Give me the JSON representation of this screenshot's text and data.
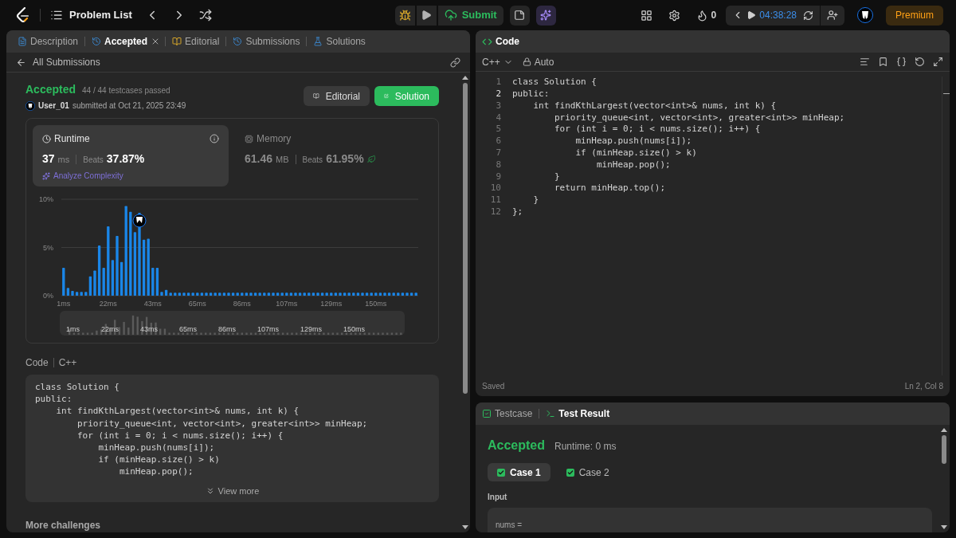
{
  "topbar": {
    "problem_list": "Problem List",
    "submit": "Submit",
    "streak": "0",
    "timer": "04:38:28",
    "premium": "Premium"
  },
  "left_panel": {
    "tabs": [
      {
        "label": "Description",
        "selected": false,
        "kind": "description",
        "closable": false
      },
      {
        "label": "Accepted",
        "selected": true,
        "kind": "history",
        "closable": true
      },
      {
        "label": "Editorial",
        "selected": false,
        "kind": "book",
        "closable": false
      },
      {
        "label": "Submissions",
        "selected": false,
        "kind": "history",
        "closable": false
      },
      {
        "label": "Solutions",
        "selected": false,
        "kind": "flask",
        "closable": false
      }
    ],
    "back": "All Submissions",
    "result": {
      "status": "Accepted",
      "testcases": "44 / 44 testcases passed",
      "user": "User_01",
      "submitted": "submitted at Oct 21, 2025 23:49"
    },
    "buttons": [
      {
        "label": "Editorial",
        "kind": "secondary"
      },
      {
        "label": "Solution",
        "kind": "primary"
      }
    ],
    "stats": [
      {
        "kind": "runtime",
        "title": "Runtime",
        "value": "37",
        "unit": "ms",
        "beats_label": "Beats",
        "beats": "37.87%",
        "selected": true,
        "link": "Analyze Complexity"
      },
      {
        "kind": "memory",
        "title": "Memory",
        "value": "61.46",
        "unit": "MB",
        "beats_label": "Beats",
        "beats": "61.95%",
        "selected": false
      }
    ],
    "chart_data": {
      "type": "bar",
      "ylim": [
        0,
        10
      ],
      "yticks": [
        {
          "value": 0,
          "label": "0%"
        },
        {
          "value": 5,
          "label": "5%"
        },
        {
          "value": 10,
          "label": "10%"
        }
      ],
      "categories": [
        "1ms",
        null,
        null,
        null,
        null,
        null,
        null,
        null,
        null,
        null,
        "22ms",
        null,
        null,
        null,
        null,
        null,
        null,
        null,
        null,
        null,
        "43ms",
        null,
        null,
        null,
        null,
        null,
        null,
        null,
        null,
        null,
        "65ms",
        null,
        null,
        null,
        null,
        null,
        null,
        null,
        null,
        null,
        "86ms",
        null,
        null,
        null,
        null,
        null,
        null,
        null,
        null,
        null,
        "107ms",
        null,
        null,
        null,
        null,
        null,
        null,
        null,
        null,
        null,
        "129ms",
        null,
        null,
        null,
        null,
        null,
        null,
        null,
        null,
        null,
        "150ms",
        null,
        null,
        null,
        null,
        null,
        null,
        null,
        null,
        null
      ],
      "values": [
        2.9,
        0.8,
        0.5,
        0.4,
        0.4,
        0.4,
        2.0,
        2.6,
        5.2,
        2.9,
        7.2,
        3.7,
        6.2,
        3.5,
        9.3,
        8.7,
        6.6,
        8.6,
        5.8,
        5.9,
        2.9,
        2.9,
        0.4,
        0.6,
        0.3,
        0.3,
        0.3,
        0.3,
        0.3,
        0.3,
        0.3,
        0.3,
        0.3,
        0.3,
        0.3,
        0.3,
        0.3,
        0.3,
        0.3,
        0.3,
        0.3,
        0.3,
        0.3,
        0.3,
        0.3,
        0.3,
        0.3,
        0.3,
        0.3,
        0.3,
        0.3,
        0.3,
        0.3,
        0.3,
        0.3,
        0.3,
        0.3,
        0.3,
        0.3,
        0.3,
        0.3,
        0.3,
        0.3,
        0.3,
        0.3,
        0.3,
        0.3,
        0.3,
        0.3,
        0.3,
        0.3,
        0.3,
        0.3,
        0.3,
        0.3,
        0.3,
        0.3,
        0.3,
        0.3,
        0.3
      ]
    },
    "brush_labels": [
      "1ms",
      "22ms",
      "43ms",
      "65ms",
      "86ms",
      "107ms",
      "129ms",
      "150ms"
    ],
    "code_label": "Code",
    "code_language": "C++",
    "code_lines": [
      "class Solution {",
      "public:",
      "    int findKthLargest(vector<int>& nums, int k) {",
      "        priority_queue<int, vector<int>, greater<int>> minHeap;",
      "        for (int i = 0; i < nums.size(); i++) {",
      "            minHeap.push(nums[i]);",
      "            if (minHeap.size() > k)",
      "                minHeap.pop();"
    ],
    "view_more": "View more",
    "more_challenges": "More challenges"
  },
  "editor": {
    "title": "Code",
    "language": "C++",
    "mode": "Auto",
    "lines": [
      {
        "number": "1",
        "text": "class Solution {",
        "active": false
      },
      {
        "number": "2",
        "text": "public:",
        "active": true
      },
      {
        "number": "3",
        "text": "    int findKthLargest(vector<int>& nums, int k) {",
        "active": false
      },
      {
        "number": "4",
        "text": "        priority_queue<int, vector<int>, greater<int>> minHeap;",
        "active": false
      },
      {
        "number": "5",
        "text": "        for (int i = 0; i < nums.size(); i++) {",
        "active": false
      },
      {
        "number": "6",
        "text": "            minHeap.push(nums[i]);",
        "active": false
      },
      {
        "number": "7",
        "text": "            if (minHeap.size() > k)",
        "active": false
      },
      {
        "number": "8",
        "text": "                minHeap.pop();",
        "active": false
      },
      {
        "number": "9",
        "text": "        }",
        "active": false
      },
      {
        "number": "10",
        "text": "        return minHeap.top();",
        "active": false
      },
      {
        "number": "11",
        "text": "    }",
        "active": false
      },
      {
        "number": "12",
        "text": "};",
        "active": false
      }
    ],
    "status": "Saved",
    "cursor": "Ln 2, Col 8"
  },
  "bottom_panel": {
    "tabs": [
      {
        "label": "Testcase",
        "selected": false,
        "kind": "check"
      },
      {
        "label": "Test Result",
        "selected": true,
        "kind": "terminal"
      }
    ],
    "status": "Accepted",
    "runtime": "Runtime: 0 ms",
    "cases": [
      {
        "label": "Case 1",
        "selected": true,
        "passed": true
      },
      {
        "label": "Case 2",
        "selected": false,
        "passed": true
      }
    ],
    "input_label": "Input",
    "param": "nums ="
  }
}
